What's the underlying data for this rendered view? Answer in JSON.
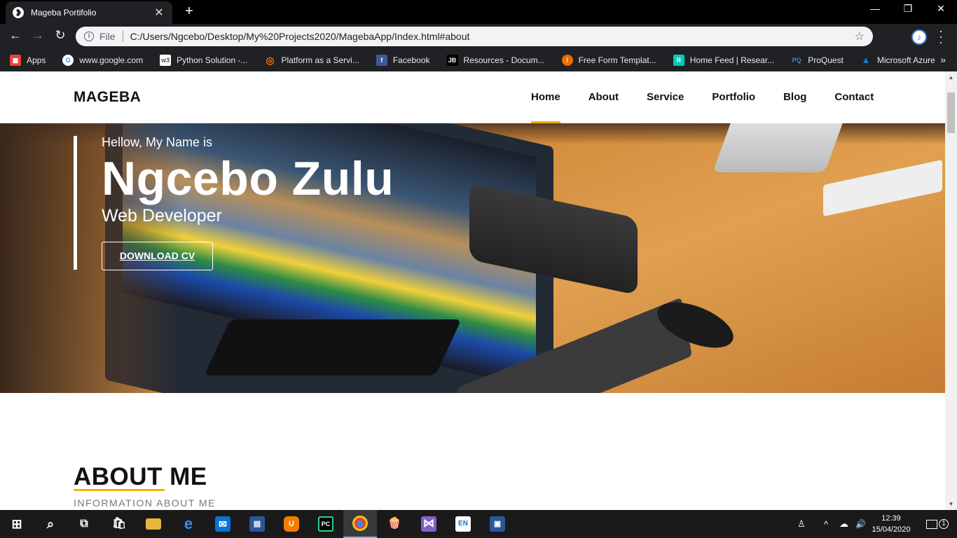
{
  "browser": {
    "tab_title": "Mageba Portifolio",
    "tab_close": "✕",
    "new_tab": "+",
    "window_controls": {
      "minimize": "—",
      "restore": "❐",
      "close": "✕"
    },
    "nav": {
      "back": "←",
      "forward": "→",
      "reload": "↻"
    },
    "address": {
      "scheme_label": "File",
      "url": "C:/Users/Ngcebo/Desktop/My%20Projects2020/MagebaApp/Index.html#about",
      "star": "☆"
    },
    "profile_glyph": "♪",
    "menu": "⋮",
    "bookmarks": [
      {
        "label": "Apps",
        "icon": "apps-grid-icon",
        "color": "#e94235"
      },
      {
        "label": "www.google.com",
        "icon": "google-icon",
        "color": "#4285f4"
      },
      {
        "label": "Python  Solution -...",
        "icon": "w3-icon",
        "color": "#555555"
      },
      {
        "label": "Platform as a Servi...",
        "icon": "eye-icon",
        "color": "#e8710a"
      },
      {
        "label": "Facebook",
        "icon": "facebook-icon",
        "color": "#3b5998"
      },
      {
        "label": "Resources - Docum...",
        "icon": "jb-icon",
        "color": "#202124"
      },
      {
        "label": "Free Form Templat...",
        "icon": "form-icon",
        "color": "#ef6c00"
      },
      {
        "label": "Home Feed | Resear...",
        "icon": "researchgate-icon",
        "color": "#00ccbb"
      },
      {
        "label": "ProQuest",
        "icon": "proquest-icon",
        "color": "#202124"
      },
      {
        "label": "Microsoft Azure",
        "icon": "azure-icon",
        "color": "#0089d6"
      }
    ],
    "bookmarks_more": "»"
  },
  "site": {
    "brand": "MAGEBA",
    "nav": [
      "Home",
      "About",
      "Service",
      "Portfolio",
      "Blog",
      "Contact"
    ],
    "active_nav": "Home",
    "accent": "#f5b301",
    "hero": {
      "greeting": "Hellow, My Name is",
      "name": "Ngcebo Zulu",
      "role": "Web Developer",
      "cta": "DOWNLOAD CV"
    },
    "about": {
      "title": "ABOUT ME",
      "subtitle": "INFORMATION ABOUT ME"
    }
  },
  "taskbar": {
    "items": [
      {
        "name": "start-button",
        "glyph": "⊞",
        "color": "#1a1a1a"
      },
      {
        "name": "search-icon",
        "glyph": "⌕",
        "color": "#1a1a1a"
      },
      {
        "name": "task-view-icon",
        "glyph": "⧉",
        "color": "#1a1a1a"
      },
      {
        "name": "store-icon",
        "glyph": "🛍",
        "color": "#1a1a1a"
      },
      {
        "name": "file-explorer-icon",
        "glyph": "",
        "color": "#e8b43a"
      },
      {
        "name": "edge-icon",
        "glyph": "e",
        "color": "#0a74d6"
      },
      {
        "name": "mail-icon",
        "glyph": "✉",
        "color": "#0a74d6"
      },
      {
        "name": "news-icon",
        "glyph": "▤",
        "color": "#2b5797"
      },
      {
        "name": "uc-browser-icon",
        "glyph": "U",
        "color": "#f57c00"
      },
      {
        "name": "pycharm-icon",
        "glyph": "PC",
        "color": "#21d789"
      },
      {
        "name": "chrome-icon",
        "glyph": "◉",
        "color": "#db4437"
      },
      {
        "name": "popcorn-icon",
        "glyph": "🍿",
        "color": "#1a1a1a"
      },
      {
        "name": "visual-studio-icon",
        "glyph": "⋈",
        "color": "#865fc5"
      },
      {
        "name": "en-keyboard-icon",
        "glyph": "EN",
        "color": "#0a74d6"
      },
      {
        "name": "word-icon",
        "glyph": "▣",
        "color": "#2b5797"
      }
    ],
    "active_item": "chrome-icon",
    "tray": {
      "people": "♙",
      "chevron": "^",
      "network": "☁",
      "volume": "🔊",
      "time": "12:39",
      "date": "15/04/2020",
      "notifications": "1"
    }
  }
}
